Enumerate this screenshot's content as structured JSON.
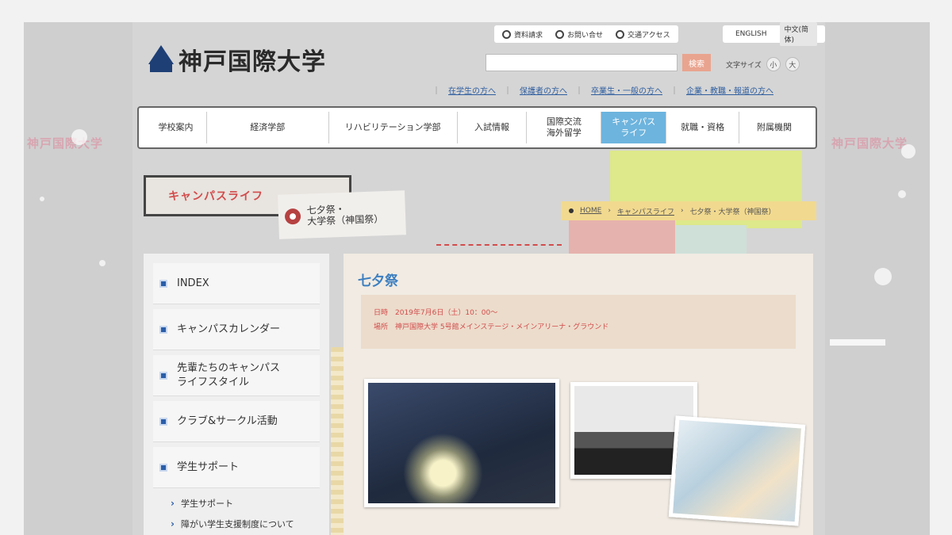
{
  "header": {
    "logo_text": "神戸国際大学",
    "utility_links": [
      "資料請求",
      "お問い合せ",
      "交通アクセス"
    ],
    "languages": [
      "ENGLISH",
      "中文(简体)"
    ],
    "search": {
      "placeholder": "",
      "button_label": "検索"
    },
    "font_size": {
      "label": "文字サイズ",
      "small": "小",
      "large": "大"
    },
    "audience_links": [
      "在学生の方へ",
      "保護者の方へ",
      "卒業生・一般の方へ",
      "企業・教職・報道の方へ"
    ]
  },
  "global_nav": {
    "items": [
      {
        "label": "学校案内"
      },
      {
        "label": "経済学部"
      },
      {
        "label": "リハビリテーション学部"
      },
      {
        "label": "入試情報"
      },
      {
        "label": "国際交流\n海外留学"
      },
      {
        "label": "キャンパス\nライフ",
        "active": true
      },
      {
        "label": "就職・資格"
      },
      {
        "label": "附属機関"
      }
    ]
  },
  "page_title": {
    "section": "キャンパスライフ",
    "subtitle": "七夕祭・\n大学祭（神国祭）"
  },
  "breadcrumb": [
    "HOME",
    "キャンパスライフ",
    "七夕祭・大学祭（神国祭）"
  ],
  "sidebar": {
    "items": [
      {
        "label": "INDEX"
      },
      {
        "label": "キャンパスカレンダー"
      },
      {
        "label": "先輩たちのキャンパス\nライフスタイル"
      },
      {
        "label": "クラブ&サークル活動"
      },
      {
        "label": "学生サポート"
      }
    ],
    "sub_links": [
      "学生サポート",
      "障がい学生支援制度について"
    ]
  },
  "content": {
    "heading": "七夕祭",
    "info_date": "日時　2019年7月6日（土）10：00～",
    "info_place": "場所　神戸国際大学 5号館メインステージ・メインアリーナ・グラウンド"
  },
  "side_decor_text": {
    "left": "神戸国際大学",
    "right": "神戸国際大学"
  },
  "colors": {
    "accent_blue": "#6db4de",
    "heading_blue": "#3d7fc0",
    "red": "#d24c4c",
    "breadcrumb_bg": "#f1d98f"
  }
}
